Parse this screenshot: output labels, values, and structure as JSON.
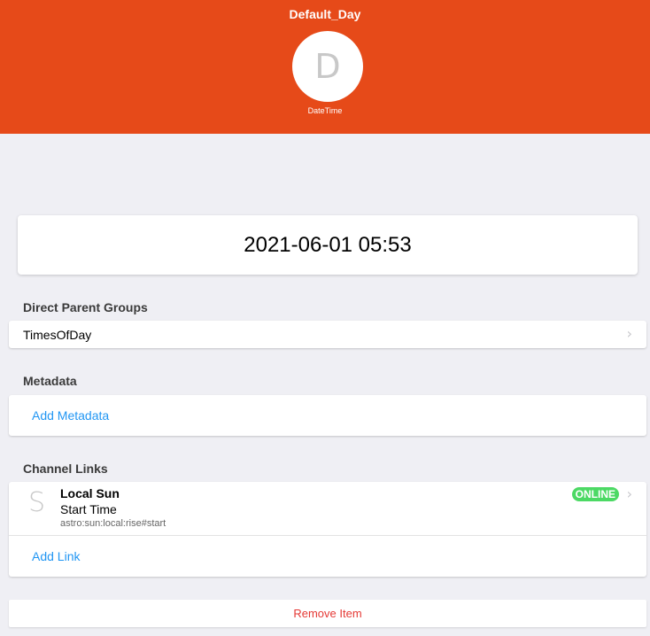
{
  "header": {
    "title": "Default_Day",
    "avatar_letter": "D",
    "item_type": "DateTime",
    "accent_color": "#e64a19"
  },
  "state": {
    "value": "2021-06-01 05:53"
  },
  "parent_groups": {
    "title": "Direct Parent Groups",
    "items": [
      {
        "label": "TimesOfDay",
        "icon": "chevron-right-icon"
      }
    ]
  },
  "metadata": {
    "title": "Metadata",
    "add_label": "Add Metadata"
  },
  "channel_links": {
    "title": "Channel Links",
    "items": [
      {
        "letter": "S",
        "thing": "Local Sun",
        "channel": "Start Time",
        "uid": "astro:sun:local:rise#start",
        "status": "ONLINE",
        "status_color": "#4cd964"
      }
    ],
    "add_label": "Add Link"
  },
  "actions": {
    "remove_label": "Remove Item",
    "remove_color": "#e53935"
  }
}
